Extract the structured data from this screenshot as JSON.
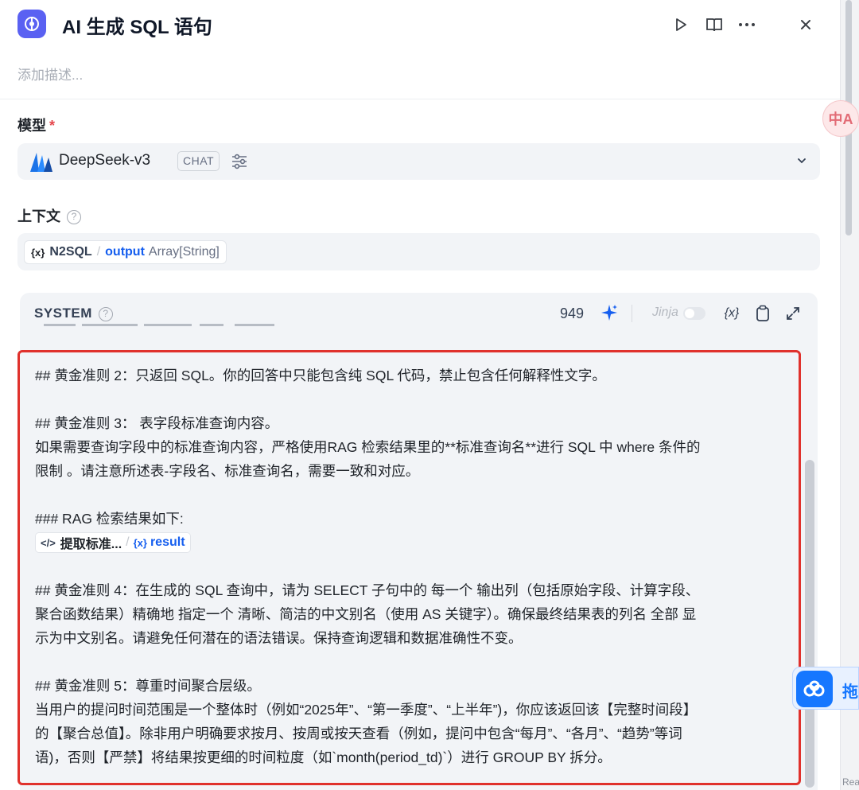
{
  "header": {
    "title": "AI 生成 SQL 语句",
    "description_placeholder": "添加描述..."
  },
  "model": {
    "label": "模型",
    "required_mark": "*",
    "name": "DeepSeek-v3",
    "mode_badge": "CHAT"
  },
  "context": {
    "label": "上下文",
    "variable": {
      "node": "N2SQL",
      "separator": "/",
      "name": "output",
      "type": "Array[String]"
    }
  },
  "system": {
    "label": "SYSTEM",
    "token_count": "949",
    "jinja_label": "Jinja",
    "jinja_enabled": false,
    "var_button": "{x}",
    "lines": [
      " ## 黄金准则 2：只返回 SQL。你的回答中只能包含纯 SQL 代码，禁止包含任何解释性文字。",
      "",
      "## 黄金准则 3： 表字段标准查询内容。",
      "如果需要查询字段中的标准查询内容，严格使用RAG 检索结果里的**标准查询名**进行 SQL 中 where 条件的",
      "限制 。请注意所述表-字段名、标准查询名，需要一致和对应。",
      "",
      "### RAG 检索结果如下:",
      "__REF__",
      "",
      "## 黄金准则 4：在生成的 SQL 查询中，请为 SELECT 子句中的 每一个 输出列（包括原始字段、计算字段、",
      "聚合函数结果）精确地 指定一个 清晰、简洁的中文别名（使用 AS 关键字）。确保最终结果表的列名 全部 显",
      "示为中文别名。请避免任何潜在的语法错误。保持查询逻辑和数据准确性不变。",
      "",
      "## 黄金准则 5：尊重时间聚合层级。",
      "当用户的提问时间范围是一个整体时（例如“2025年”、“第一季度”、“上半年”)，你应该返回该【完整时间段】",
      "的【聚合总值】。除非用户明确要求按月、按周或按天查看（例如，提问中包含“每月”、“各月”、“趋势”等词",
      "语)，否则【严禁】将结果按更细的时间粒度（如`month(period_td)`）进行 GROUP BY 拆分。"
    ],
    "reference": {
      "node": "提取标准...",
      "separator": "/",
      "var": "result"
    }
  },
  "floating": {
    "translate_label": "中A",
    "drag_label": "拖"
  },
  "right_edge_fragment": "React Flow",
  "colors": {
    "accent": "#155eef",
    "app_icon": "#5a61f2",
    "highlight_border": "#e0312c",
    "required": "#e5484d"
  }
}
